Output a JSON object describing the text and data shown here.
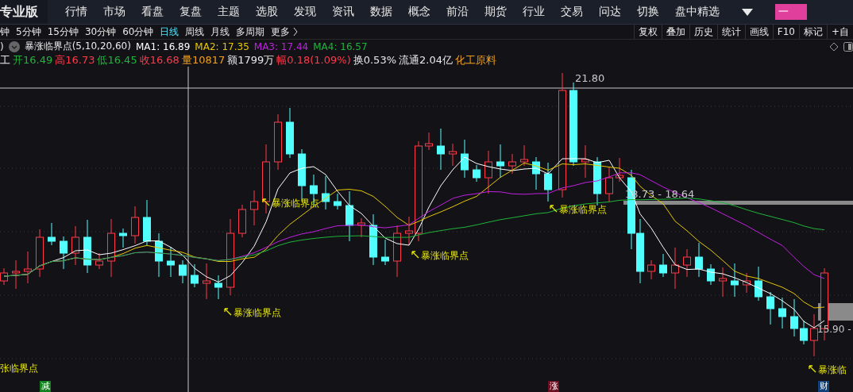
{
  "app": {
    "edition": "专业版"
  },
  "nav": [
    "行情",
    "市场",
    "看盘",
    "复盘",
    "主题",
    "选股",
    "发现",
    "资讯",
    "数据",
    "概念",
    "前沿",
    "期货",
    "行业",
    "交易",
    "问达",
    "切换",
    "盘中精选"
  ],
  "promo_button": "一",
  "periods": [
    {
      "label": "钟",
      "selected": false
    },
    {
      "label": "5分钟",
      "selected": false
    },
    {
      "label": "15分钟",
      "selected": false
    },
    {
      "label": "30分钟",
      "selected": false
    },
    {
      "label": "60分钟",
      "selected": false
    },
    {
      "label": "日线",
      "selected": true
    },
    {
      "label": "周线",
      "selected": false
    },
    {
      "label": "月线",
      "selected": false
    },
    {
      "label": "多周期",
      "selected": false
    },
    {
      "label": "更多",
      "selected": false
    }
  ],
  "tools": [
    "复权",
    "叠加",
    "历史",
    "统计",
    "画线",
    "F10",
    "标记",
    "+自"
  ],
  "indicator": {
    "prefix": ")",
    "name": "暴涨临界点(5,10,20,60)",
    "mas": [
      {
        "label": "MA1: 16.89",
        "color": "#ffffff"
      },
      {
        "label": "MA2: 17.35",
        "color": "#e6c800"
      },
      {
        "label": "MA3: 17.44",
        "color": "#c020e0"
      },
      {
        "label": "MA4: 16.57",
        "color": "#1fb43a"
      }
    ]
  },
  "quote": [
    {
      "text": "工",
      "color": "#e8e8e8"
    },
    {
      "text": "开16.49",
      "color": "#1fb43a"
    },
    {
      "text": "高16.73",
      "color": "#ff3a4a"
    },
    {
      "text": "低16.45",
      "color": "#1fb43a"
    },
    {
      "text": "收16.68",
      "color": "#ff3a4a"
    },
    {
      "text": "量10817",
      "color": "#f0a020"
    },
    {
      "text": "额1799万",
      "color": "#e8e8e8"
    },
    {
      "text": "幅0.18(1.09%)",
      "color": "#ff3a4a"
    },
    {
      "text": "换0.53%",
      "color": "#e8e8e8"
    },
    {
      "text": "流通2.04亿",
      "color": "#e8e8e8"
    },
    {
      "text": "化工原料",
      "color": "#f0a020"
    }
  ],
  "chart": {
    "price_labels": [
      "21.80",
      "18.73 - 18.64",
      "15.90 -"
    ],
    "annotations": [
      "暴涨临界点",
      "暴涨临界点",
      "暴涨临界点",
      "暴涨临界点",
      "张临界点",
      "暴涨临"
    ],
    "markers": [
      {
        "text": "减",
        "color": "#14821e"
      },
      {
        "text": "涨",
        "color": "#6a1020"
      },
      {
        "text": "财",
        "color": "#12407a"
      }
    ]
  }
}
